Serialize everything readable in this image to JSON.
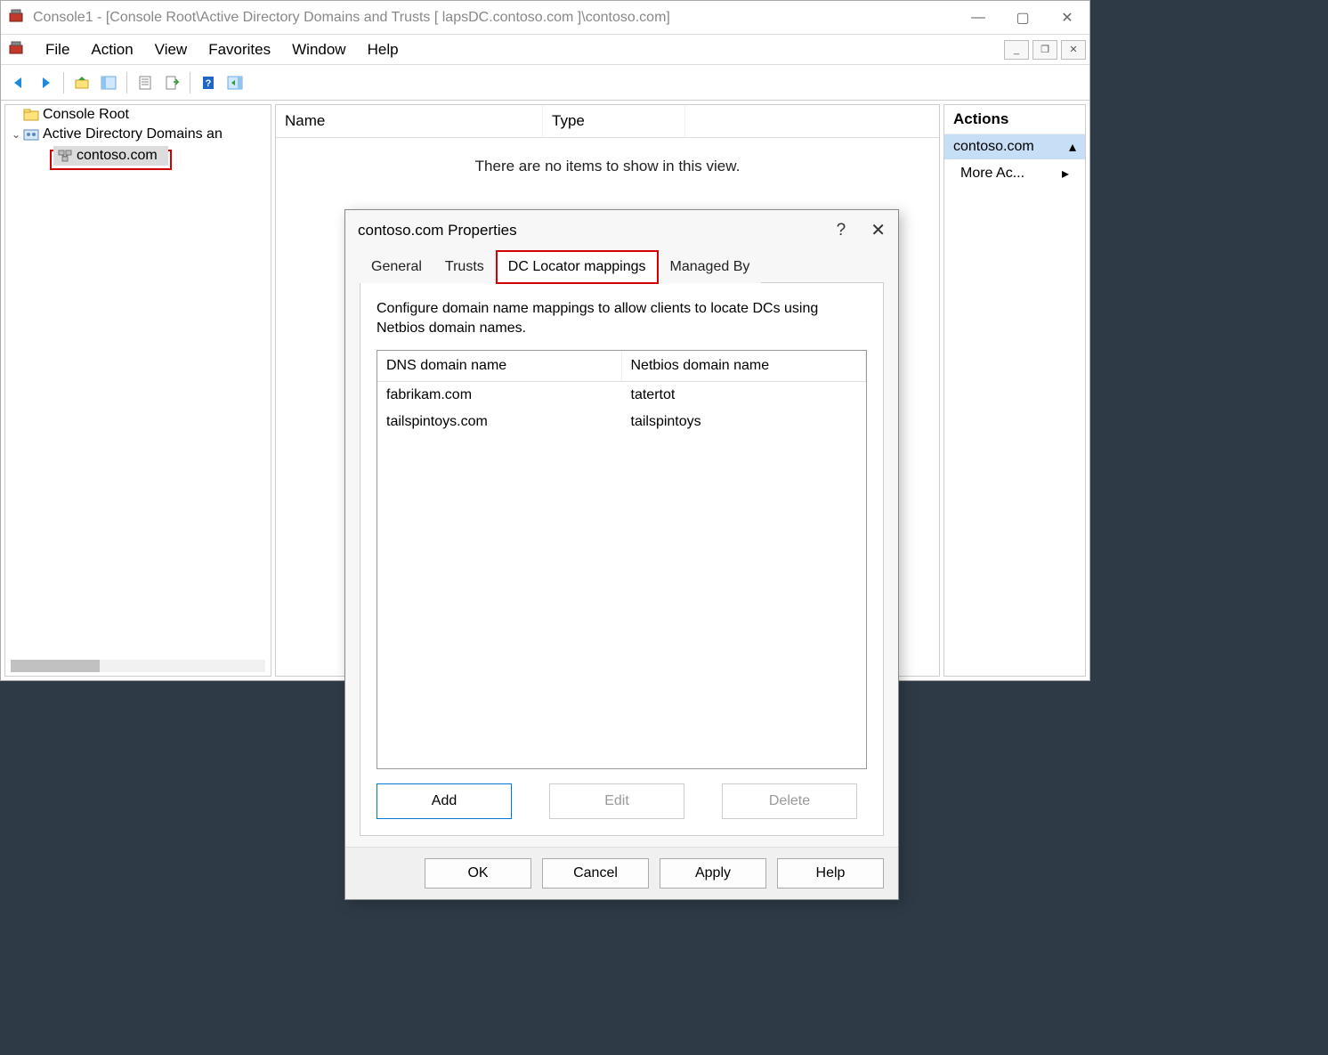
{
  "titlebar": {
    "title": "Console1 - [Console Root\\Active Directory Domains and Trusts [ lapsDC.contoso.com ]\\contoso.com]"
  },
  "menubar": {
    "items": [
      "File",
      "Action",
      "View",
      "Favorites",
      "Window",
      "Help"
    ]
  },
  "tree": {
    "root": "Console Root",
    "snapin": "Active Directory Domains an",
    "domain": "contoso.com"
  },
  "list": {
    "cols": [
      "Name",
      "Type"
    ],
    "empty": "There are no items to show in this view."
  },
  "actions": {
    "title": "Actions",
    "group": "contoso.com",
    "more": "More Ac..."
  },
  "dialog": {
    "title": "contoso.com Properties",
    "tabs": [
      "General",
      "Trusts",
      "DC Locator mappings",
      "Managed By"
    ],
    "desc": "Configure domain name mappings to allow clients to locate DCs using Netbios domain names.",
    "headers": [
      "DNS domain name",
      "Netbios domain name"
    ],
    "rows": [
      {
        "dns": "fabrikam.com",
        "nb": "tatertot"
      },
      {
        "dns": "tailspintoys.com",
        "nb": "tailspintoys"
      }
    ],
    "buttons": {
      "add": "Add",
      "edit": "Edit",
      "delete": "Delete"
    },
    "footer": {
      "ok": "OK",
      "cancel": "Cancel",
      "apply": "Apply",
      "help": "Help"
    }
  }
}
